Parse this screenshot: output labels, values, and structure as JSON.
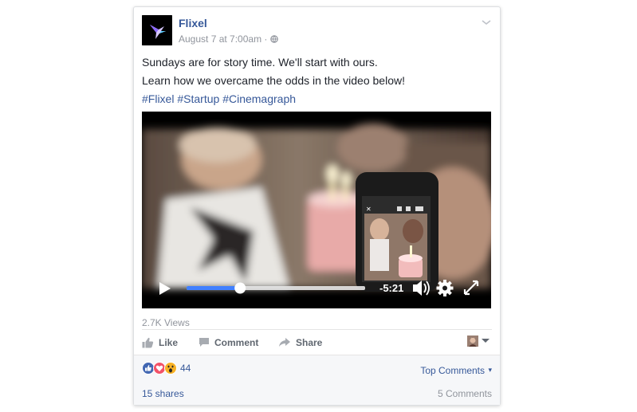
{
  "post": {
    "page_name": "Flixel",
    "timestamp": "August 7 at 7:00am",
    "separator": "·",
    "privacy_icon": "globe-icon",
    "line1": "Sundays are for story time. We'll start with ours.",
    "line2": "Learn how we overcame the odds in the video below!",
    "hashtags": [
      "#Flixel",
      "#Startup",
      "#Cinemagraph"
    ]
  },
  "video": {
    "time_remaining": "-5:21",
    "progress_fraction": 0.3
  },
  "stats": {
    "views": "2.7K Views"
  },
  "actions": {
    "like": "Like",
    "comment": "Comment",
    "share": "Share"
  },
  "reactions": {
    "count": "44",
    "types": [
      "like",
      "love",
      "wow"
    ],
    "top_comments": "Top Comments",
    "top_comments_caret": "▾"
  },
  "footer": {
    "shares": "15 shares",
    "comments": "5 Comments"
  },
  "colors": {
    "link": "#365899",
    "muted": "#90949c",
    "like_blue": "#4267b2",
    "love_red": "#f25268",
    "wow_yellow": "#f7b125",
    "progress_blue": "#4080ff"
  }
}
